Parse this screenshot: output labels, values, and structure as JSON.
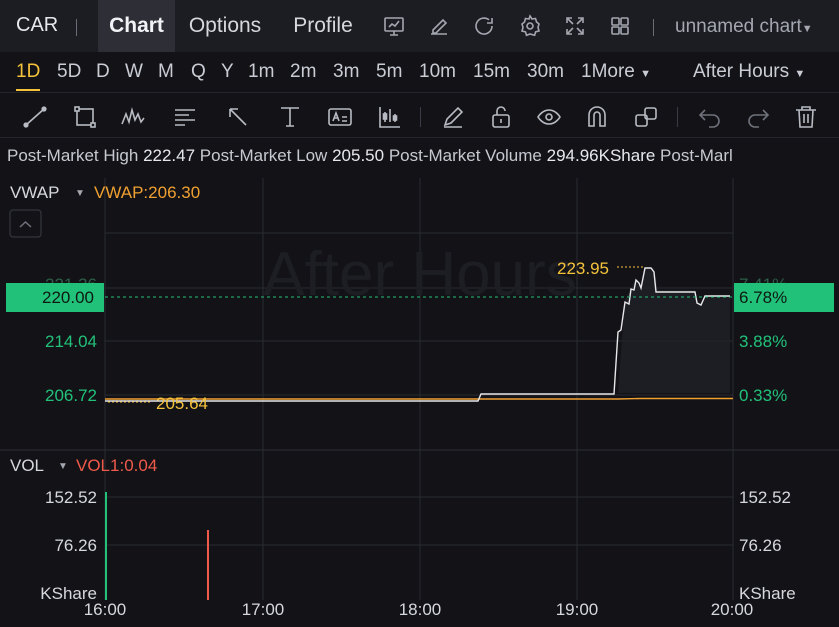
{
  "header": {
    "symbol": "CAR",
    "tabs": [
      {
        "label": "Chart",
        "active": true
      },
      {
        "label": "Options",
        "active": false
      },
      {
        "label": "Profile",
        "active": false
      }
    ],
    "chart_name": "unnamed chart",
    "icons": [
      "presentation-icon",
      "edit-icon",
      "refresh-icon",
      "settings-icon",
      "fullscreen-icon",
      "layout-grid-icon"
    ]
  },
  "timeframes": {
    "items": [
      "1D",
      "5D",
      "D",
      "W",
      "M",
      "Q",
      "Y",
      "1m",
      "2m",
      "3m",
      "5m",
      "10m",
      "15m",
      "30m",
      "1More"
    ],
    "active": "1D",
    "session": "After Hours"
  },
  "toolbar": {
    "icons": [
      "trend-line-icon",
      "rectangle-icon",
      "pattern-icon",
      "fib-icon",
      "arrow-icon",
      "measure-icon",
      "text-icon",
      "indicator-icon",
      "pen-icon",
      "unlock-icon",
      "eye-icon",
      "magnet-icon",
      "copy-icon",
      "undo-icon",
      "redo-icon",
      "trash-icon"
    ]
  },
  "info": {
    "high_label": "Post-Market High",
    "high_value": "222.47",
    "low_label": "Post-Market Low",
    "low_value": "205.50",
    "volume_label": "Post-Market Volume",
    "volume_value": "294.96KShare",
    "cut_label": "Post-Marl"
  },
  "price_panel": {
    "indicator": "VWAP",
    "indicator_value": "VWAP:206.30",
    "watermark": "After Hours",
    "current_price": "220.00",
    "current_pct": "6.78%",
    "y_left": [
      "214.04",
      "206.72"
    ],
    "y_right": [
      "3.88%",
      "0.33%"
    ],
    "high_marker": "223.95",
    "low_marker": "205.64",
    "partial_left": "221.36",
    "partial_right": "7.41%"
  },
  "volume_panel": {
    "indicator": "VOL",
    "indicator_value": "VOL1:0.04",
    "y_left": [
      "152.52",
      "76.26",
      "KShare"
    ],
    "y_right": [
      "152.52",
      "76.26",
      "KShare"
    ]
  },
  "x_axis": [
    "16:00",
    "17:00",
    "18:00",
    "19:00",
    "20:00"
  ],
  "colors": {
    "up": "#22c17a",
    "down": "#f05a4a",
    "vwap": "#f0a030",
    "accent": "#f5c33b",
    "price_line": "#e8e8ea"
  }
}
